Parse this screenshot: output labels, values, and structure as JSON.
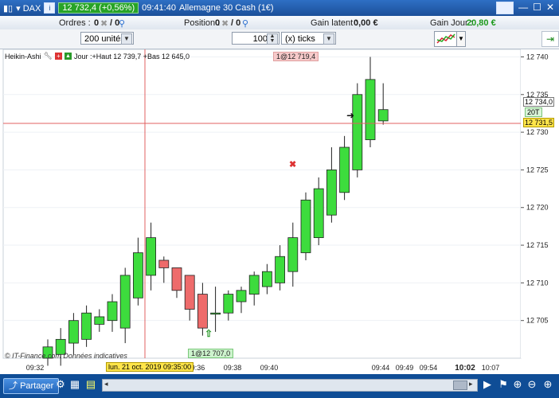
{
  "titlebar": {
    "dropdown_label": "DAX",
    "info_icon": "i",
    "price_pill": "12 732,4 (+0,56%)",
    "time": "09:41:40",
    "instrument": "Allemagne 30 Cash (1€)"
  },
  "infobar": {
    "orders_label": "Ordres :",
    "orders_value": "0",
    "orders_sep": "/ 0",
    "position_label": "Position :",
    "position_value": "0",
    "position_sep": "/ 0",
    "latent_label": "Gain latent :",
    "latent_value": "0,00 €",
    "day_label": "Gain Jour :",
    "day_value": "20,80 €"
  },
  "toolbar": {
    "units": "200 unités",
    "qty": "100",
    "ticks": "(x) ticks"
  },
  "chart": {
    "indicator": "Heikin-Ashi",
    "day_info": "Jour :+Haut 12 739,7 +Bas 12 645,0",
    "order_top": "1@12 719,4",
    "order_bottom": "1@12 707,0",
    "watermark": "© IT-Finance.com Données indicatives",
    "cursor_date": "lun. 21 oct. 2019 09:35:00",
    "price_marker_current": "12 734,0",
    "price_marker_tag": "20T",
    "price_marker_last": "12 731,5",
    "y_ticks": [
      "12 740",
      "12 735",
      "12 730",
      "12 725",
      "12 720",
      "12 715",
      "12 710",
      "12 705"
    ],
    "x_ticks": [
      "09:32",
      "09:36",
      "09:38",
      "09:40",
      "09:44",
      "09:49",
      "09:54",
      "10:02",
      "10:07"
    ]
  },
  "chart_data": {
    "type": "candlestick",
    "title": "",
    "xlabel": "",
    "ylabel": "",
    "ylim": [
      12700,
      12741
    ],
    "candles": [
      {
        "open": 12700,
        "close": 12701.5,
        "high": 12702.5,
        "low": 12699
      },
      {
        "open": 12700.5,
        "close": 12702.5,
        "high": 12704,
        "low": 12699
      },
      {
        "open": 12702,
        "close": 12705,
        "high": 12706,
        "low": 12700.5
      },
      {
        "open": 12702.5,
        "close": 12706,
        "high": 12707,
        "low": 12701.5
      },
      {
        "open": 12704.5,
        "close": 12705.5,
        "high": 12706.5,
        "low": 12703.5
      },
      {
        "open": 12705,
        "close": 12707.5,
        "high": 12708.5,
        "low": 12703.5
      },
      {
        "open": 12704,
        "close": 12711,
        "high": 12712,
        "low": 12702
      },
      {
        "open": 12708,
        "close": 12714,
        "high": 12716,
        "low": 12707
      },
      {
        "open": 12711,
        "close": 12716,
        "high": 12718,
        "low": 12709
      },
      {
        "open": 12713,
        "close": 12712,
        "high": 12713.5,
        "low": 12710
      },
      {
        "open": 12712,
        "close": 12709,
        "high": 12712,
        "low": 12708
      },
      {
        "open": 12711,
        "close": 12706.5,
        "high": 12711,
        "low": 12705
      },
      {
        "open": 12708.5,
        "close": 12704,
        "high": 12710,
        "low": 12703
      },
      {
        "open": 12706,
        "close": 12706,
        "high": 12709.5,
        "low": 12703.5
      },
      {
        "open": 12706,
        "close": 12708.5,
        "high": 12709,
        "low": 12705
      },
      {
        "open": 12707.5,
        "close": 12709,
        "high": 12709.5,
        "low": 12706
      },
      {
        "open": 12708.5,
        "close": 12711,
        "high": 12711.5,
        "low": 12707
      },
      {
        "open": 12709.5,
        "close": 12711.5,
        "high": 12712.5,
        "low": 12708.5
      },
      {
        "open": 12710,
        "close": 12713.5,
        "high": 12715,
        "low": 12709
      },
      {
        "open": 12711.5,
        "close": 12716,
        "high": 12718,
        "low": 12709.5
      },
      {
        "open": 12714,
        "close": 12721,
        "high": 12722,
        "low": 12713
      },
      {
        "open": 12716,
        "close": 12722.5,
        "high": 12724,
        "low": 12715
      },
      {
        "open": 12719,
        "close": 12725,
        "high": 12728,
        "low": 12718
      },
      {
        "open": 12722,
        "close": 12728,
        "high": 12729.5,
        "low": 12721
      },
      {
        "open": 12725,
        "close": 12735,
        "high": 12736.5,
        "low": 12724
      },
      {
        "open": 12729,
        "close": 12737,
        "high": 12740,
        "low": 12728
      },
      {
        "open": 12731.5,
        "close": 12733,
        "high": 12736.5,
        "low": 12731
      }
    ]
  }
}
